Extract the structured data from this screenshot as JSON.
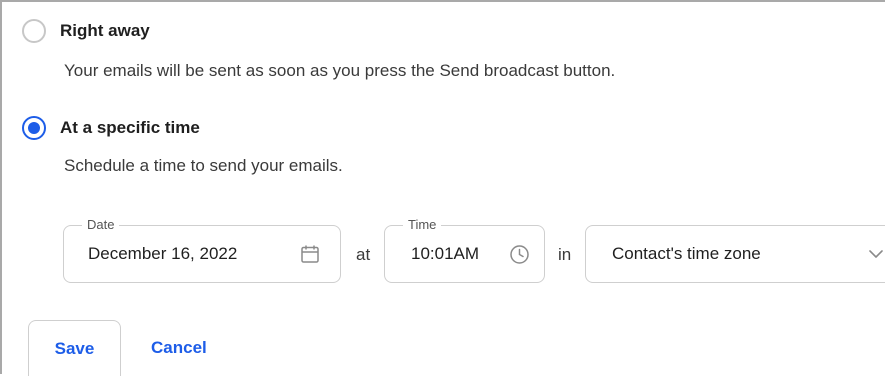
{
  "options": [
    {
      "label": "Right away",
      "description": "Your emails will be sent as soon as you press the Send broadcast button.",
      "selected": false
    },
    {
      "label": "At a specific time",
      "description": "Schedule a time to send your emails.",
      "selected": true
    }
  ],
  "schedule": {
    "date": {
      "legend": "Date",
      "value": "December 16, 2022",
      "icon": "calendar-icon"
    },
    "at_label": "at",
    "time": {
      "legend": "Time",
      "value": "10:01AM",
      "icon": "clock-icon"
    },
    "in_label": "in",
    "timezone": {
      "value": "Contact's time zone",
      "icon": "chevron-down-icon"
    }
  },
  "actions": {
    "save_label": "Save",
    "cancel_label": "Cancel"
  },
  "colors": {
    "accent": "#1d5de8",
    "border": "#cfcfcf",
    "text": "#1f1f1f"
  }
}
